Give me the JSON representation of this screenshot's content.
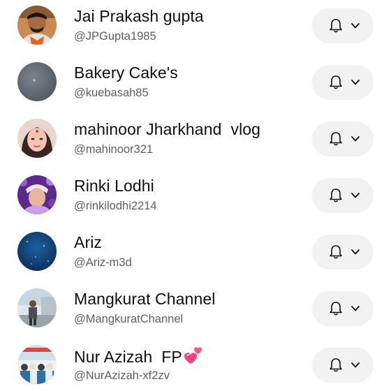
{
  "subscriptions": [
    {
      "name": "Jai Prakash gupta",
      "handle": "@JPGupta1985",
      "avatar_icon": "avatar-photo-man-orange"
    },
    {
      "name": "Bakery Cake's",
      "handle": "@kuebasah85",
      "avatar_icon": "avatar-dark-grey"
    },
    {
      "name": "mahinoor Jharkhand  vlog",
      "handle": "@mahinoor321",
      "avatar_icon": "avatar-photo-woman"
    },
    {
      "name": "Rinki Lodhi",
      "handle": "@rinkilodhi2214",
      "avatar_icon": "avatar-photo-purple"
    },
    {
      "name": "Ariz",
      "handle": "@Ariz-m3d",
      "avatar_icon": "avatar-blue-space"
    },
    {
      "name": "Mangkurat Channel",
      "handle": "@MangkuratChannel",
      "avatar_icon": "avatar-photo-outdoor"
    },
    {
      "name": "Nur Azizah  FP",
      "handle": "@NurAzizah-xf2zv",
      "avatar_icon": "avatar-photo-group",
      "name_emoji": "revolving-hearts-emoji"
    }
  ],
  "notification_button": {
    "icon": "bell-icon",
    "dropdown_icon": "chevron-down-icon"
  },
  "colors": {
    "name_text": "#0f0f0f",
    "handle_text": "#606060",
    "button_bg": "#f2f2f2",
    "heart_pink": "#ff4d8d"
  }
}
